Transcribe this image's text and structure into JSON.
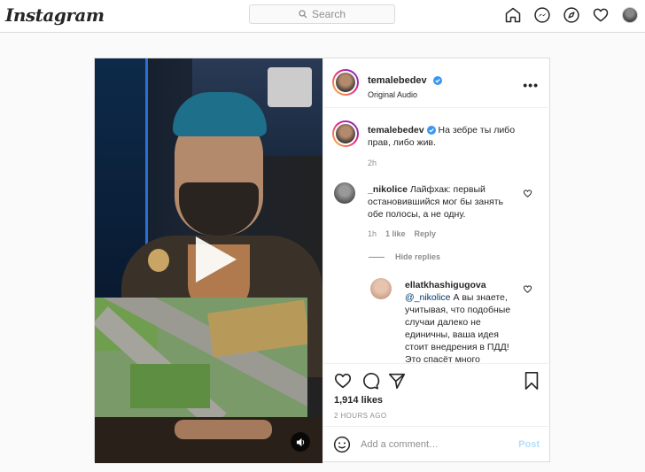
{
  "nav": {
    "logo": "Instagram",
    "search_placeholder": "Search",
    "icons": [
      "home-icon",
      "messenger-icon",
      "explore-icon",
      "heart-icon",
      "profile-avatar"
    ]
  },
  "post": {
    "author": "temalebedev",
    "audio": "Original Audio",
    "more": "•••",
    "caption_author": "temalebedev",
    "caption": "На зебре ты либо прав, либо жив.",
    "caption_time": "2h",
    "comments": [
      {
        "user": "_nikolice",
        "text": "Лайфхак: первый остановившийся мог бы занять обе полосы, а не одну.",
        "time": "1h",
        "likes": "1 like",
        "reply": "Reply"
      }
    ],
    "hide_replies": "Hide replies",
    "reply": {
      "user": "ellatkhashigugova",
      "mention": "@_nikolice",
      "text": "А вы знаете, учитывая, что подобные случаи далеко не единичны, ваша идея стоит внедрения в ПДД! Это спасёт много"
    },
    "likes_count": "1,914 likes",
    "timestamp": "2 HOURS AGO",
    "add_comment_placeholder": "Add a comment…",
    "post_button": "Post"
  },
  "colors": {
    "verified": "#3897f0",
    "mention": "#00376b",
    "post_disabled": "#b2dffc"
  }
}
